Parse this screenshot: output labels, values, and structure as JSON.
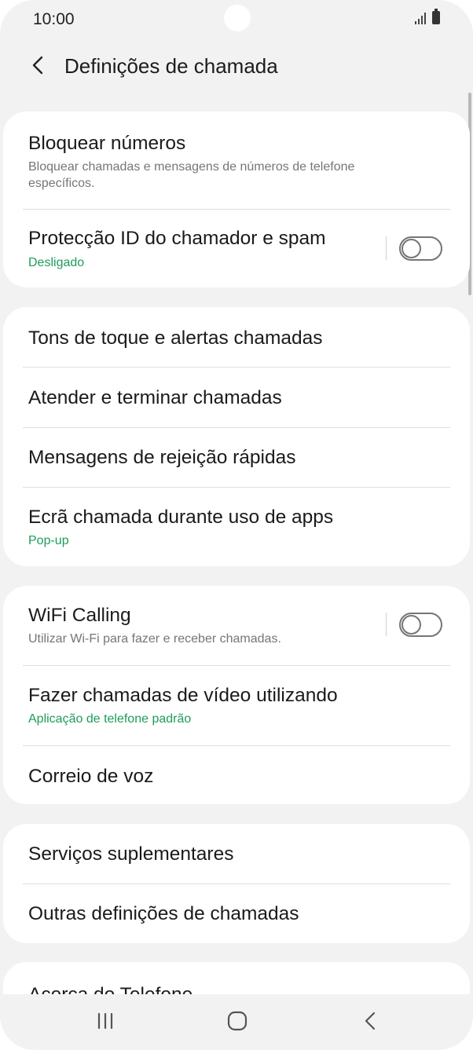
{
  "status_bar": {
    "time": "10:00"
  },
  "header": {
    "title": "Definições de chamada"
  },
  "groups": [
    {
      "items": [
        {
          "label": "Bloquear números",
          "subtitle": "Bloquear chamadas e mensagens de números de telefone específicos."
        },
        {
          "label": "Protecção ID do chamador e spam",
          "subtitle": "Desligado",
          "toggle": false
        }
      ]
    },
    {
      "items": [
        {
          "label": "Tons de toque e alertas chamadas"
        },
        {
          "label": "Atender e terminar chamadas"
        },
        {
          "label": "Mensagens de rejeição rápidas"
        },
        {
          "label": "Ecrã chamada durante uso de apps",
          "subtitle": "Pop-up"
        }
      ]
    },
    {
      "items": [
        {
          "label": "WiFi Calling",
          "subtitle": "Utilizar Wi-Fi para fazer e receber chamadas.",
          "toggle": false
        },
        {
          "label": "Fazer chamadas de vídeo utilizando",
          "subtitle": "Aplicação de telefone padrão"
        },
        {
          "label": "Correio de voz"
        }
      ]
    },
    {
      "items": [
        {
          "label": "Serviços suplementares"
        },
        {
          "label": "Outras definições de chamadas"
        }
      ]
    },
    {
      "items": [
        {
          "label": "Acerca do Telefone"
        }
      ]
    }
  ],
  "colors": {
    "accent": "#1e9c5a",
    "background": "#f2f2f2",
    "card": "#ffffff"
  }
}
